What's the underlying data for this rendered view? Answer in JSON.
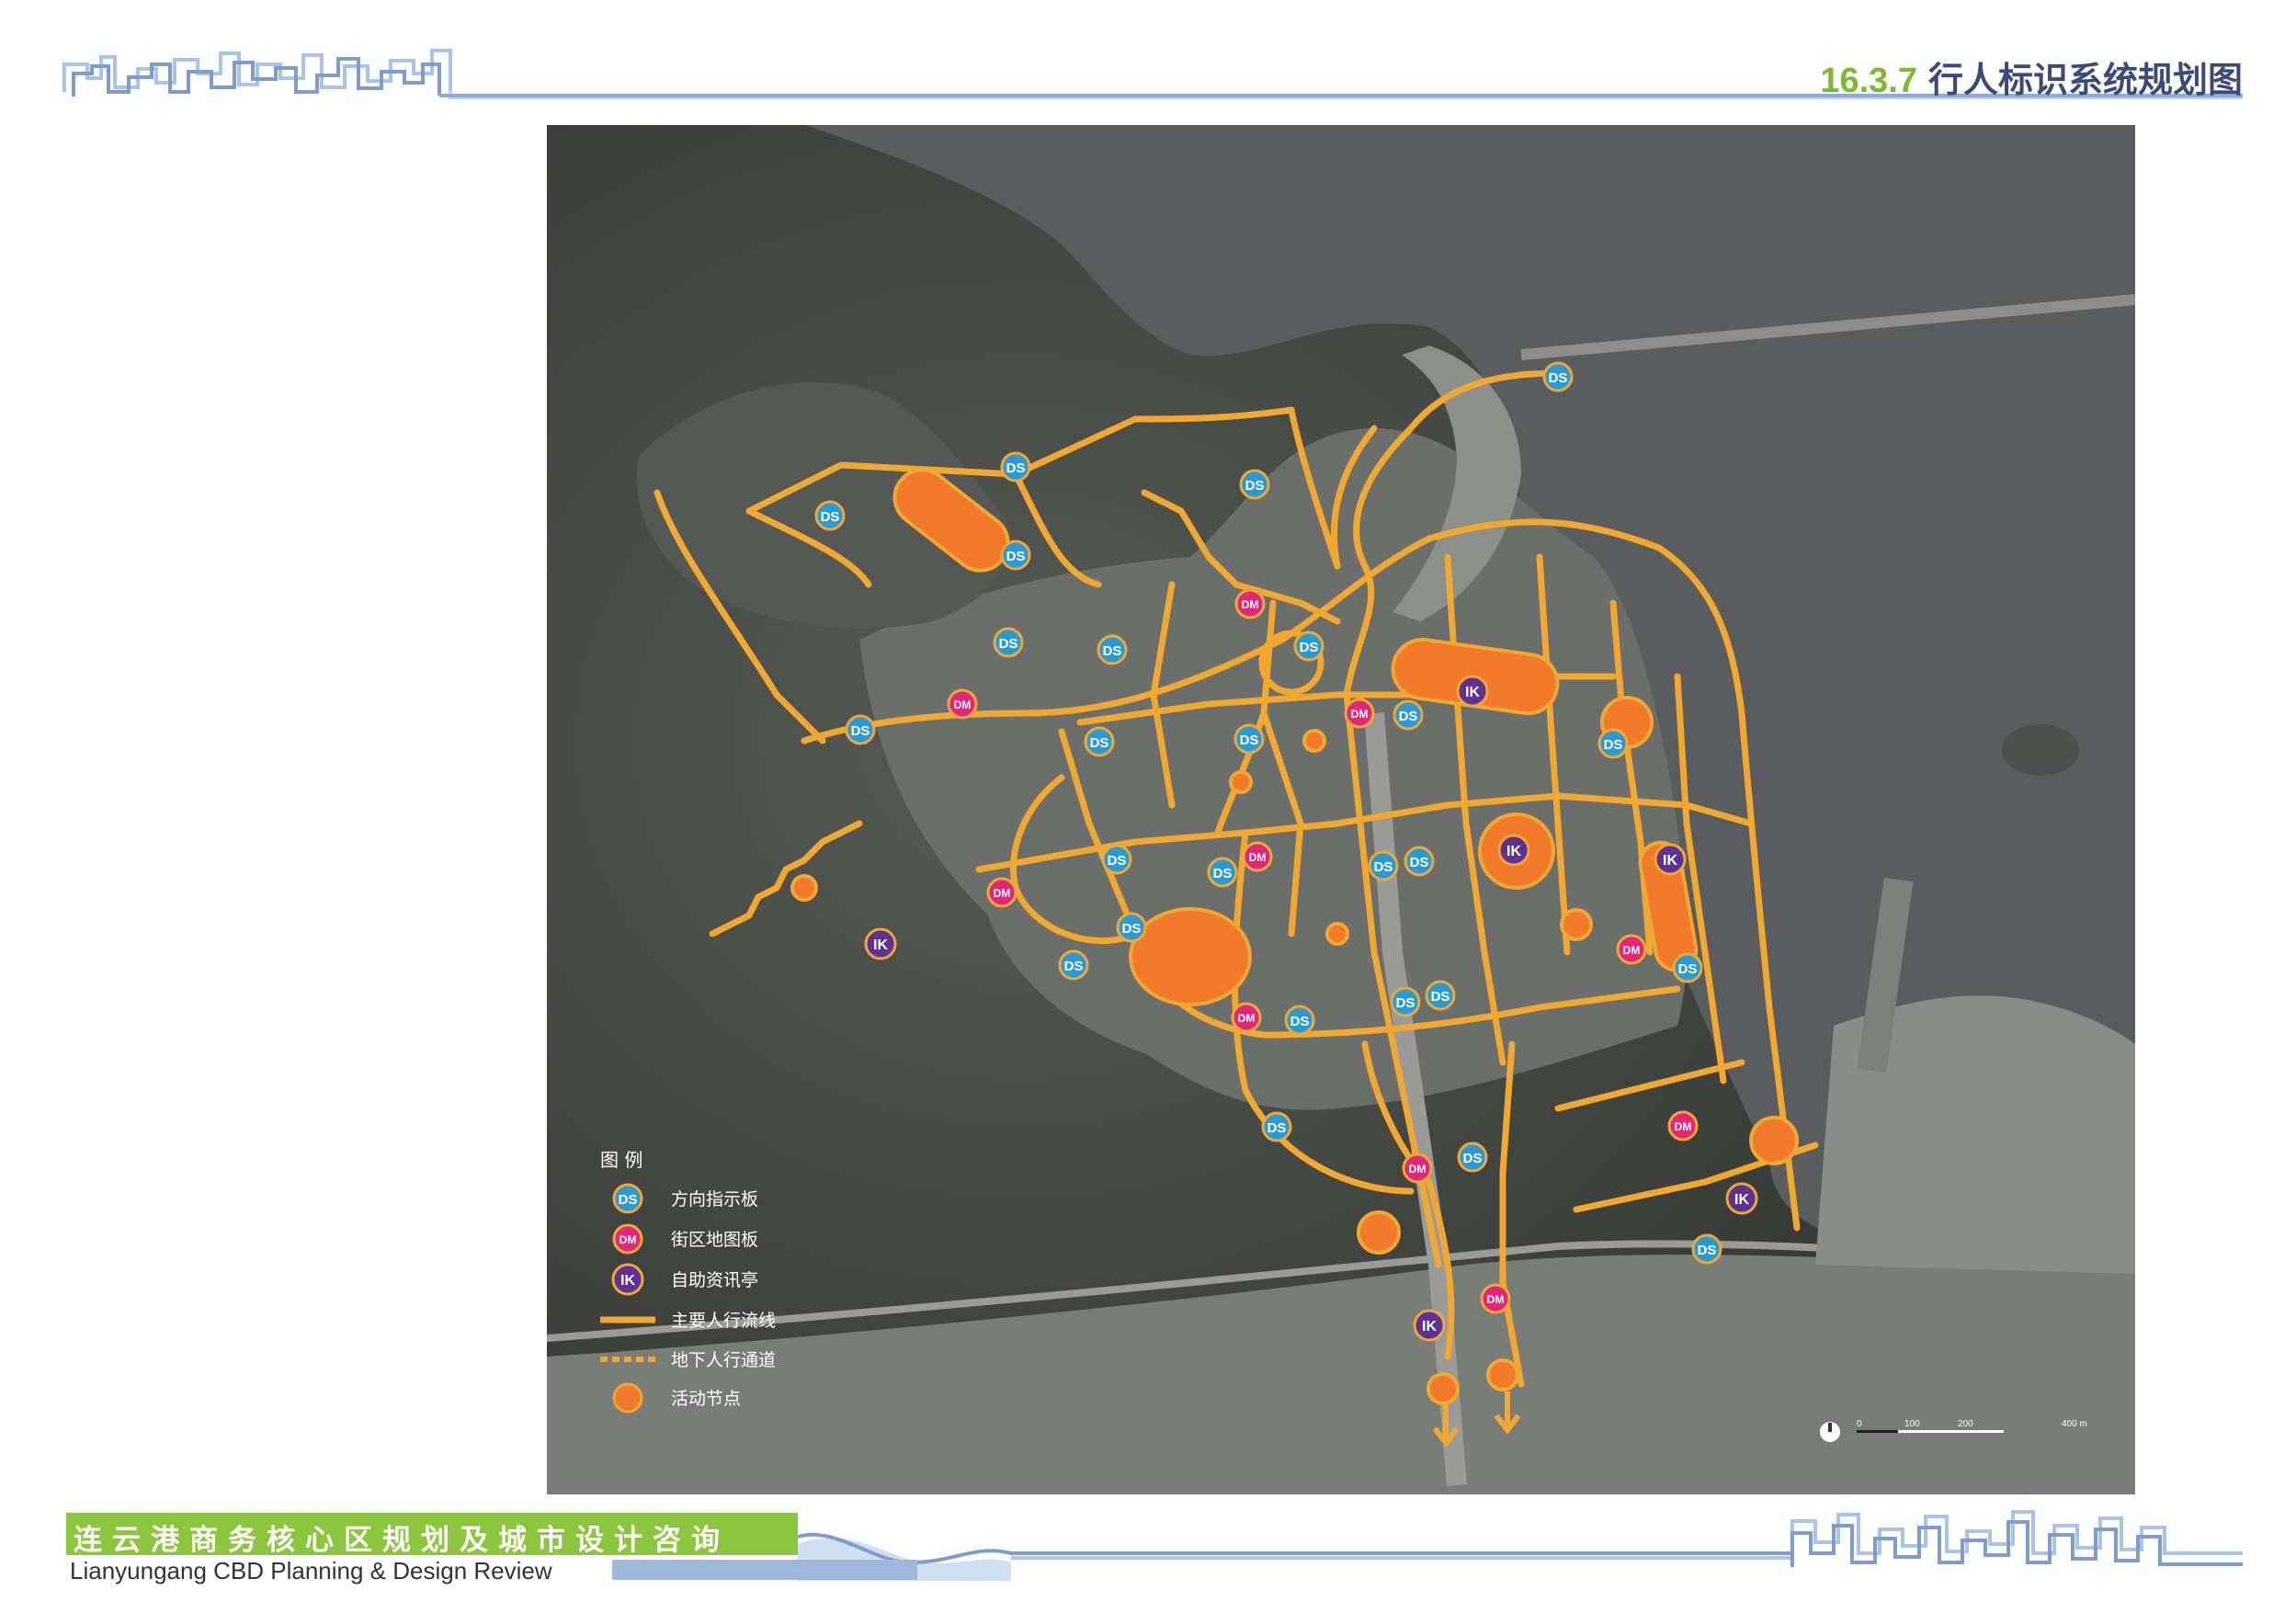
{
  "header": {
    "section_number": "16.3.7",
    "section_title": "行人标识系统规划图"
  },
  "footer": {
    "title_cn": "连云港商务核心区规划及城市设计咨询",
    "title_en": "Lianyungang CBD Planning & Design Review"
  },
  "legend": {
    "heading": "图 例",
    "items": [
      {
        "code": "DS",
        "label": "方向指示板",
        "color": "#2a9ad6"
      },
      {
        "code": "DM",
        "label": "街区地图板",
        "color": "#e2277b"
      },
      {
        "code": "IK",
        "label": "自助资讯亭",
        "color": "#5d3294"
      },
      {
        "label": "主要人行流线",
        "color": "#f0a830"
      },
      {
        "label": "地下人行通道",
        "color": "#f0a830"
      },
      {
        "label": "活动节点",
        "color": "#f07a2a"
      }
    ]
  },
  "scale_bar": {
    "labels": [
      "0",
      "100",
      "200",
      "400 m"
    ]
  },
  "colors": {
    "route": "#f0a830",
    "node": "#f07a2a",
    "water": "#5a5c5d",
    "land": "#3d3f3c",
    "ds": "#2a9ad6",
    "dm": "#e2277b",
    "ik": "#5d3294"
  },
  "markers": {
    "ds_count": 25,
    "dm_count": 10,
    "ik_count": 7
  }
}
